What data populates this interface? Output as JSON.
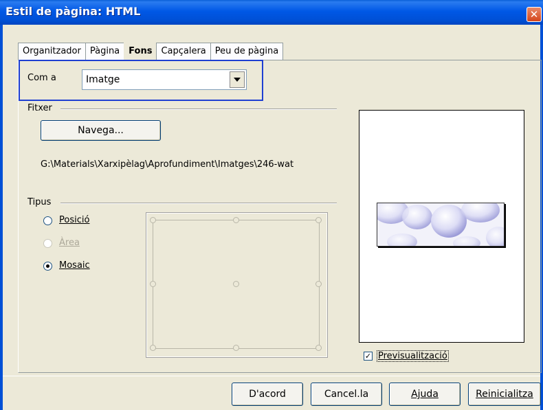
{
  "window": {
    "title": "Estil de pàgina: HTML"
  },
  "tabs": [
    "Organitzador",
    "Pàgina",
    "Fons",
    "Capçalera",
    "Peu de pàgina"
  ],
  "active_tab": "Fons",
  "background": {
    "as_label": "Com a",
    "as_value": "Imatge"
  },
  "file": {
    "group_label": "Fitxer",
    "browse_label": "Navega...",
    "path": "G:\\Materials\\Xarxipèlag\\Aprofundiment\\Imatges\\246-wat"
  },
  "type": {
    "group_label": "Tipus",
    "options": [
      {
        "label": "Posició",
        "selected": false,
        "enabled": true
      },
      {
        "label": "Àrea",
        "selected": false,
        "enabled": false
      },
      {
        "label": "Mosaic",
        "selected": true,
        "enabled": true
      }
    ]
  },
  "preview": {
    "label": "Previsualització",
    "checked": true
  },
  "buttons": {
    "ok": "D'acord",
    "cancel": "Cancel.la",
    "help": "Ajuda",
    "reset": "Reinicialitza"
  },
  "colors": {
    "titlebar": "#0058e6",
    "highlight_frame": "#1e3fd2",
    "dialog_bg": "#ece9d8"
  },
  "icons": {
    "close": "close-icon",
    "dropdown": "chevron-down-icon",
    "check": "check-icon"
  }
}
